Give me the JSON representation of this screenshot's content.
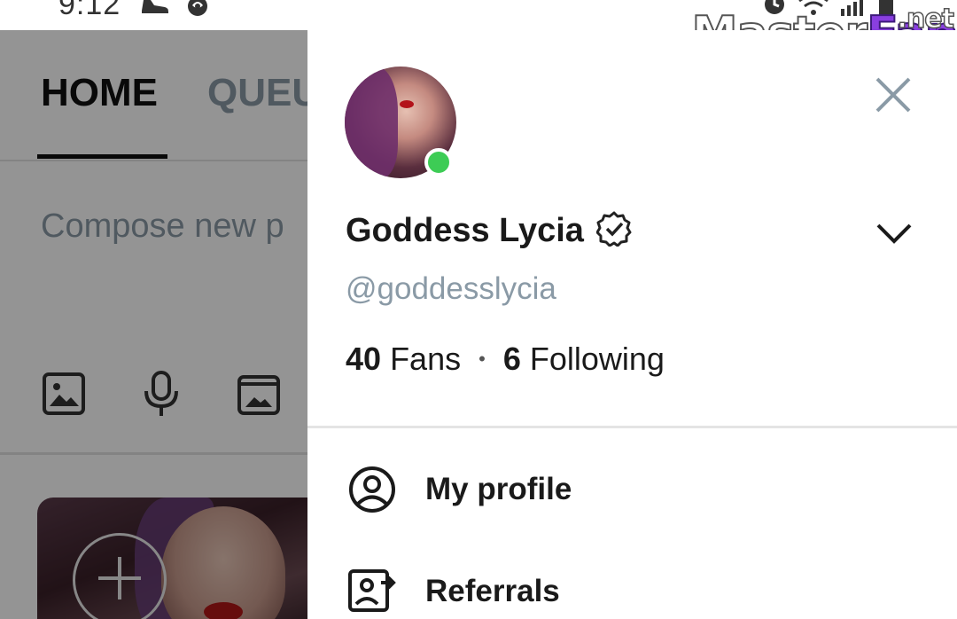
{
  "status_bar": {
    "time": "9:12",
    "icons_left": [
      "sneaker-icon",
      "rose-icon"
    ],
    "icons_right": [
      "alarm-icon",
      "wifi-icon",
      "signal-icon",
      "battery-icon"
    ]
  },
  "watermark": {
    "part1": "Master",
    "part2": "Fap",
    "suffix": ".net"
  },
  "background_app": {
    "tabs": [
      {
        "label": "HOME",
        "active": true
      },
      {
        "label": "QUEU",
        "active": false
      }
    ],
    "compose_placeholder": "Compose new p",
    "compose_tools": [
      "image-icon",
      "microphone-icon",
      "vault-icon"
    ]
  },
  "drawer": {
    "display_name": "Goddess Lycia",
    "verified": true,
    "username": "@goddesslycia",
    "online": true,
    "stats": {
      "fans_count": "40",
      "fans_label": "Fans",
      "separator": "•",
      "following_count": "6",
      "following_label": "Following"
    },
    "menu": [
      {
        "label": "My profile",
        "icon": "user-circle-icon"
      },
      {
        "label": "Referrals",
        "icon": "referrals-icon"
      }
    ]
  },
  "colors": {
    "muted": "#8a9aa6",
    "online": "#3dcc55",
    "text": "#1a1a1a",
    "divider": "#e4e4e4"
  }
}
